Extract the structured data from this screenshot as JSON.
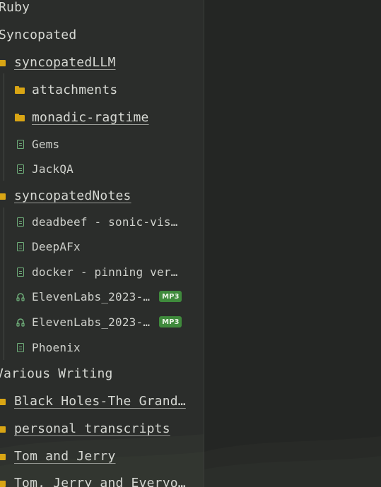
{
  "tree": {
    "ruby": {
      "label": "Ruby"
    },
    "syncopated": {
      "label": "Syncopated",
      "syncopatedLLM": {
        "label": "syncopatedLLM",
        "attachments": "attachments",
        "monadic_ragtime": "monadic-ragtime",
        "gems": "Gems",
        "jackqa": "JackQA"
      },
      "syncopatedNotes": {
        "label": "syncopatedNotes",
        "deadbeef": "deadbeef - sonic-vis…",
        "deepafx": "DeepAFx",
        "docker": "docker - pinning ver…",
        "elevenlabs1": "ElevenLabs_2023-…",
        "elevenlabs1_badge": "MP3",
        "elevenlabs2": "ElevenLabs_2023-…",
        "elevenlabs2_badge": "MP3",
        "phoenix": "Phoenix"
      }
    },
    "various_writing": {
      "label": "Various Writing",
      "black_holes": "Black Holes-The Grand…",
      "personal_transcripts": "personal transcripts",
      "tom_and_jerry": "Tom and Jerry",
      "tom_jerry_everyone": "Tom, Jerry and Everyo…"
    }
  },
  "colors": {
    "folder": "#d9a514",
    "file": "#6fae7a",
    "badge_bg": "#3f8a3c",
    "sidebar_bg": "#2b2d2b",
    "main_bg": "#242624"
  }
}
